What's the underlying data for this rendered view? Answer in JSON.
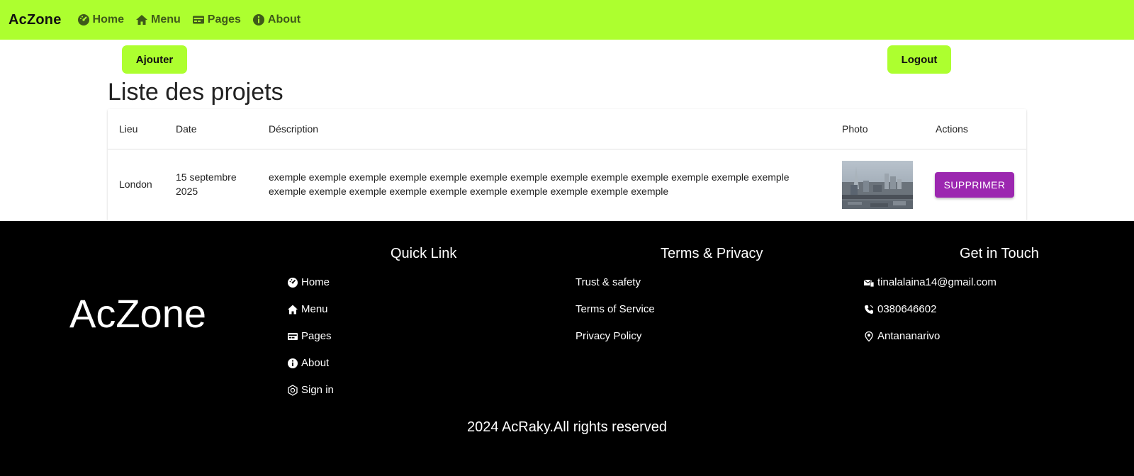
{
  "navbar": {
    "brand": "AcZone",
    "items": [
      {
        "label": "Home",
        "icon": "dashboard-icon"
      },
      {
        "label": "Menu",
        "icon": "home-icon"
      },
      {
        "label": "Pages",
        "icon": "card-icon"
      },
      {
        "label": "About",
        "icon": "info-icon"
      }
    ]
  },
  "actions": {
    "ajouter_label": "Ajouter",
    "logout_label": "Logout"
  },
  "page": {
    "title": "Liste des projets"
  },
  "table": {
    "headers": [
      "Lieu",
      "Date",
      "Déscription",
      "Photo",
      "Actions"
    ],
    "rows": [
      {
        "lieu": "London",
        "date_line1": "15 septembre",
        "date_line2": "2025",
        "description": "exemple exemple exemple exemple exemple exemple exemple exemple exemple exemple exemple exemple exemple exemple exemple exemple exemple exemple exemple exemple exemple exemple exemple",
        "delete_label": "SUPPRIMER"
      }
    ]
  },
  "footer": {
    "brand": "AcZone",
    "quick_link": {
      "title": "Quick Link",
      "items": [
        {
          "label": "Home",
          "icon": "dashboard-icon"
        },
        {
          "label": "Menu",
          "icon": "home-icon"
        },
        {
          "label": "Pages",
          "icon": "card-icon"
        },
        {
          "label": "About",
          "icon": "info-icon"
        },
        {
          "label": "Sign in",
          "icon": "sign-in-icon"
        }
      ]
    },
    "terms": {
      "title": "Terms & Privacy",
      "items": [
        "Trust & safety",
        "Terms of Service",
        "Privacy Policy"
      ]
    },
    "contact": {
      "title": "Get in Touch",
      "email": "tinalalaina14@gmail.com",
      "phone": "0380646602",
      "location": "Antananarivo"
    },
    "copyright": "2024 AcRaky.All rights reserved"
  },
  "colors": {
    "accent": "#adff2f",
    "danger": "#9c27b0",
    "footer_bg": "#000000"
  }
}
